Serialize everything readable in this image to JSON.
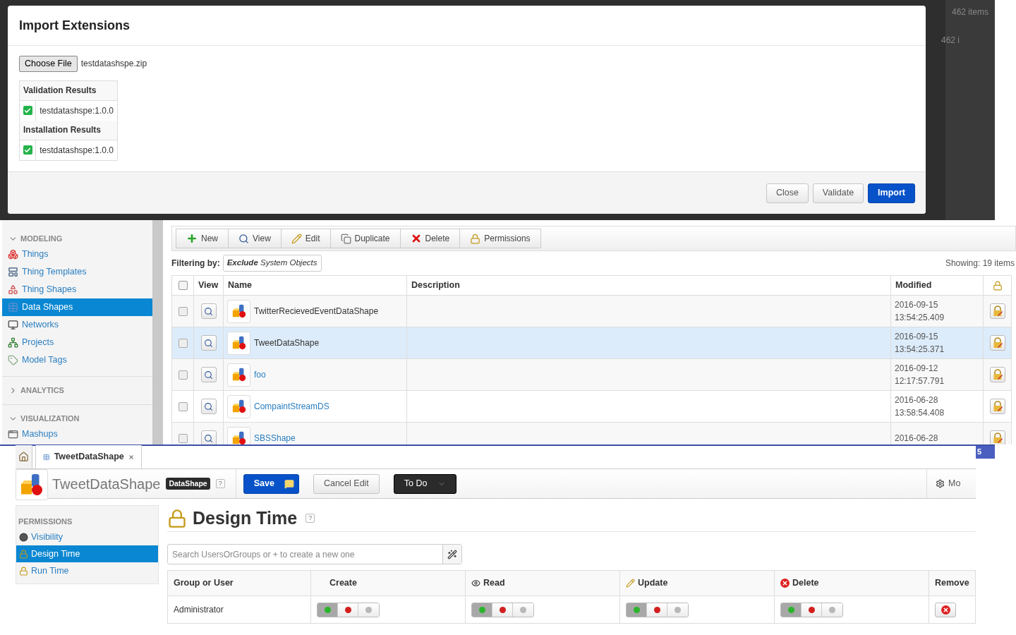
{
  "background": {
    "texts": [
      "462 items",
      "462 i"
    ]
  },
  "dialog": {
    "title": "Import Extensions",
    "file_button": "Choose File",
    "file_name": "testdatashspe.zip",
    "results": [
      {
        "heading": "Validation Results",
        "items": [
          {
            "name": "testdatashspe:1.0.0",
            "checked": true
          }
        ]
      },
      {
        "heading": "Installation Results",
        "items": [
          {
            "name": "testdatashspe:1.0.0",
            "checked": true
          }
        ]
      }
    ],
    "buttons": [
      {
        "label": "Close",
        "kind": "default"
      },
      {
        "label": "Validate",
        "kind": "default"
      },
      {
        "label": "Import",
        "kind": "primary"
      }
    ]
  },
  "sidebar": {
    "sections": [
      {
        "title": "MODELING",
        "expanded": true,
        "items": [
          {
            "label": "Things",
            "selected": false
          },
          {
            "label": "Thing Templates",
            "selected": false
          },
          {
            "label": "Thing Shapes",
            "selected": false
          },
          {
            "label": "Data Shapes",
            "selected": true
          },
          {
            "label": "Networks",
            "selected": false
          },
          {
            "label": "Projects",
            "selected": false
          },
          {
            "label": "Model Tags",
            "selected": false
          }
        ]
      },
      {
        "title": "ANALYTICS",
        "expanded": false
      },
      {
        "title": "VISUALIZATION",
        "expanded": true,
        "items": [
          {
            "label": "Mashups",
            "selected": false
          }
        ]
      }
    ]
  },
  "toolbar": [
    {
      "label": "New"
    },
    {
      "label": "View"
    },
    {
      "label": "Edit"
    },
    {
      "label": "Duplicate"
    },
    {
      "label": "Delete"
    },
    {
      "label": "Permissions"
    }
  ],
  "filter": {
    "label": "Filtering by:",
    "value": "**Exclude** System Objects"
  },
  "showing": "Showing: 19 items",
  "table": {
    "select_all": {
      "checked": false
    },
    "columns": [
      "View",
      "Name",
      "Description",
      "Modified"
    ],
    "rows": [
      {
        "name": "TwitterRecievedEventDataShape",
        "kind": "plain",
        "selected": false,
        "checked": false,
        "modified_date": "2016-09-15",
        "modified_time": "13:54:25.409"
      },
      {
        "name": "TweetDataShape",
        "kind": "plain",
        "selected": true,
        "checked": false,
        "modified_date": "2016-09-15",
        "modified_time": "13:54:25.371"
      },
      {
        "name": "foo",
        "kind": "link",
        "selected": false,
        "checked": false,
        "modified_date": "2016-09-12",
        "modified_time": "12:17:57.791"
      },
      {
        "name": "CompaintStreamDS",
        "kind": "link",
        "selected": false,
        "checked": false,
        "modified_date": "2016-06-28",
        "modified_time": "13:58:54.408"
      },
      {
        "name": "SBSShape",
        "kind": "link",
        "selected": false,
        "checked": false,
        "modified_date": "2016-06-28"
      }
    ]
  },
  "badge": "5",
  "tab": {
    "label": "TweetDataShape"
  },
  "entity": {
    "name": "TweetDataShape",
    "type": "DataShape",
    "help": "?"
  },
  "actions": [
    {
      "label": "Save",
      "kind": "primary"
    },
    {
      "label": "Cancel Edit",
      "kind": "default"
    },
    {
      "label": "To Do",
      "kind": "dark"
    }
  ],
  "more": "Mo",
  "permissions_nav": {
    "title": "PERMISSIONS",
    "items": [
      {
        "label": "Visibility",
        "selected": false
      },
      {
        "label": "Design Time",
        "selected": true
      },
      {
        "label": "Run Time",
        "selected": false
      }
    ]
  },
  "page": {
    "title": "Design Time",
    "help": "?",
    "search_placeholder": "Search UsersOrGroups or + to create a new one"
  },
  "grid": {
    "columns": [
      "Group or User",
      "Create",
      "Read",
      "Update",
      "Delete",
      "Remove"
    ],
    "rows": [
      {
        "name": "Administrator",
        "permissions": [
          {
            "options": [
              {
                "color": "#2bb52b",
                "selected": true
              },
              {
                "color": "#d21f1f",
                "selected": false
              },
              {
                "color": "#b8b8b8",
                "selected": false
              }
            ]
          },
          {
            "options": [
              {
                "color": "#2bb52b",
                "selected": true
              },
              {
                "color": "#d21f1f",
                "selected": false
              },
              {
                "color": "#b8b8b8",
                "selected": false
              }
            ]
          },
          {
            "options": [
              {
                "color": "#2bb52b",
                "selected": true
              },
              {
                "color": "#d21f1f",
                "selected": false
              },
              {
                "color": "#b8b8b8",
                "selected": false
              }
            ]
          },
          {
            "options": [
              {
                "color": "#2bb52b",
                "selected": true
              },
              {
                "color": "#d21f1f",
                "selected": false
              },
              {
                "color": "#b8b8b8",
                "selected": false
              }
            ]
          }
        ]
      }
    ]
  }
}
